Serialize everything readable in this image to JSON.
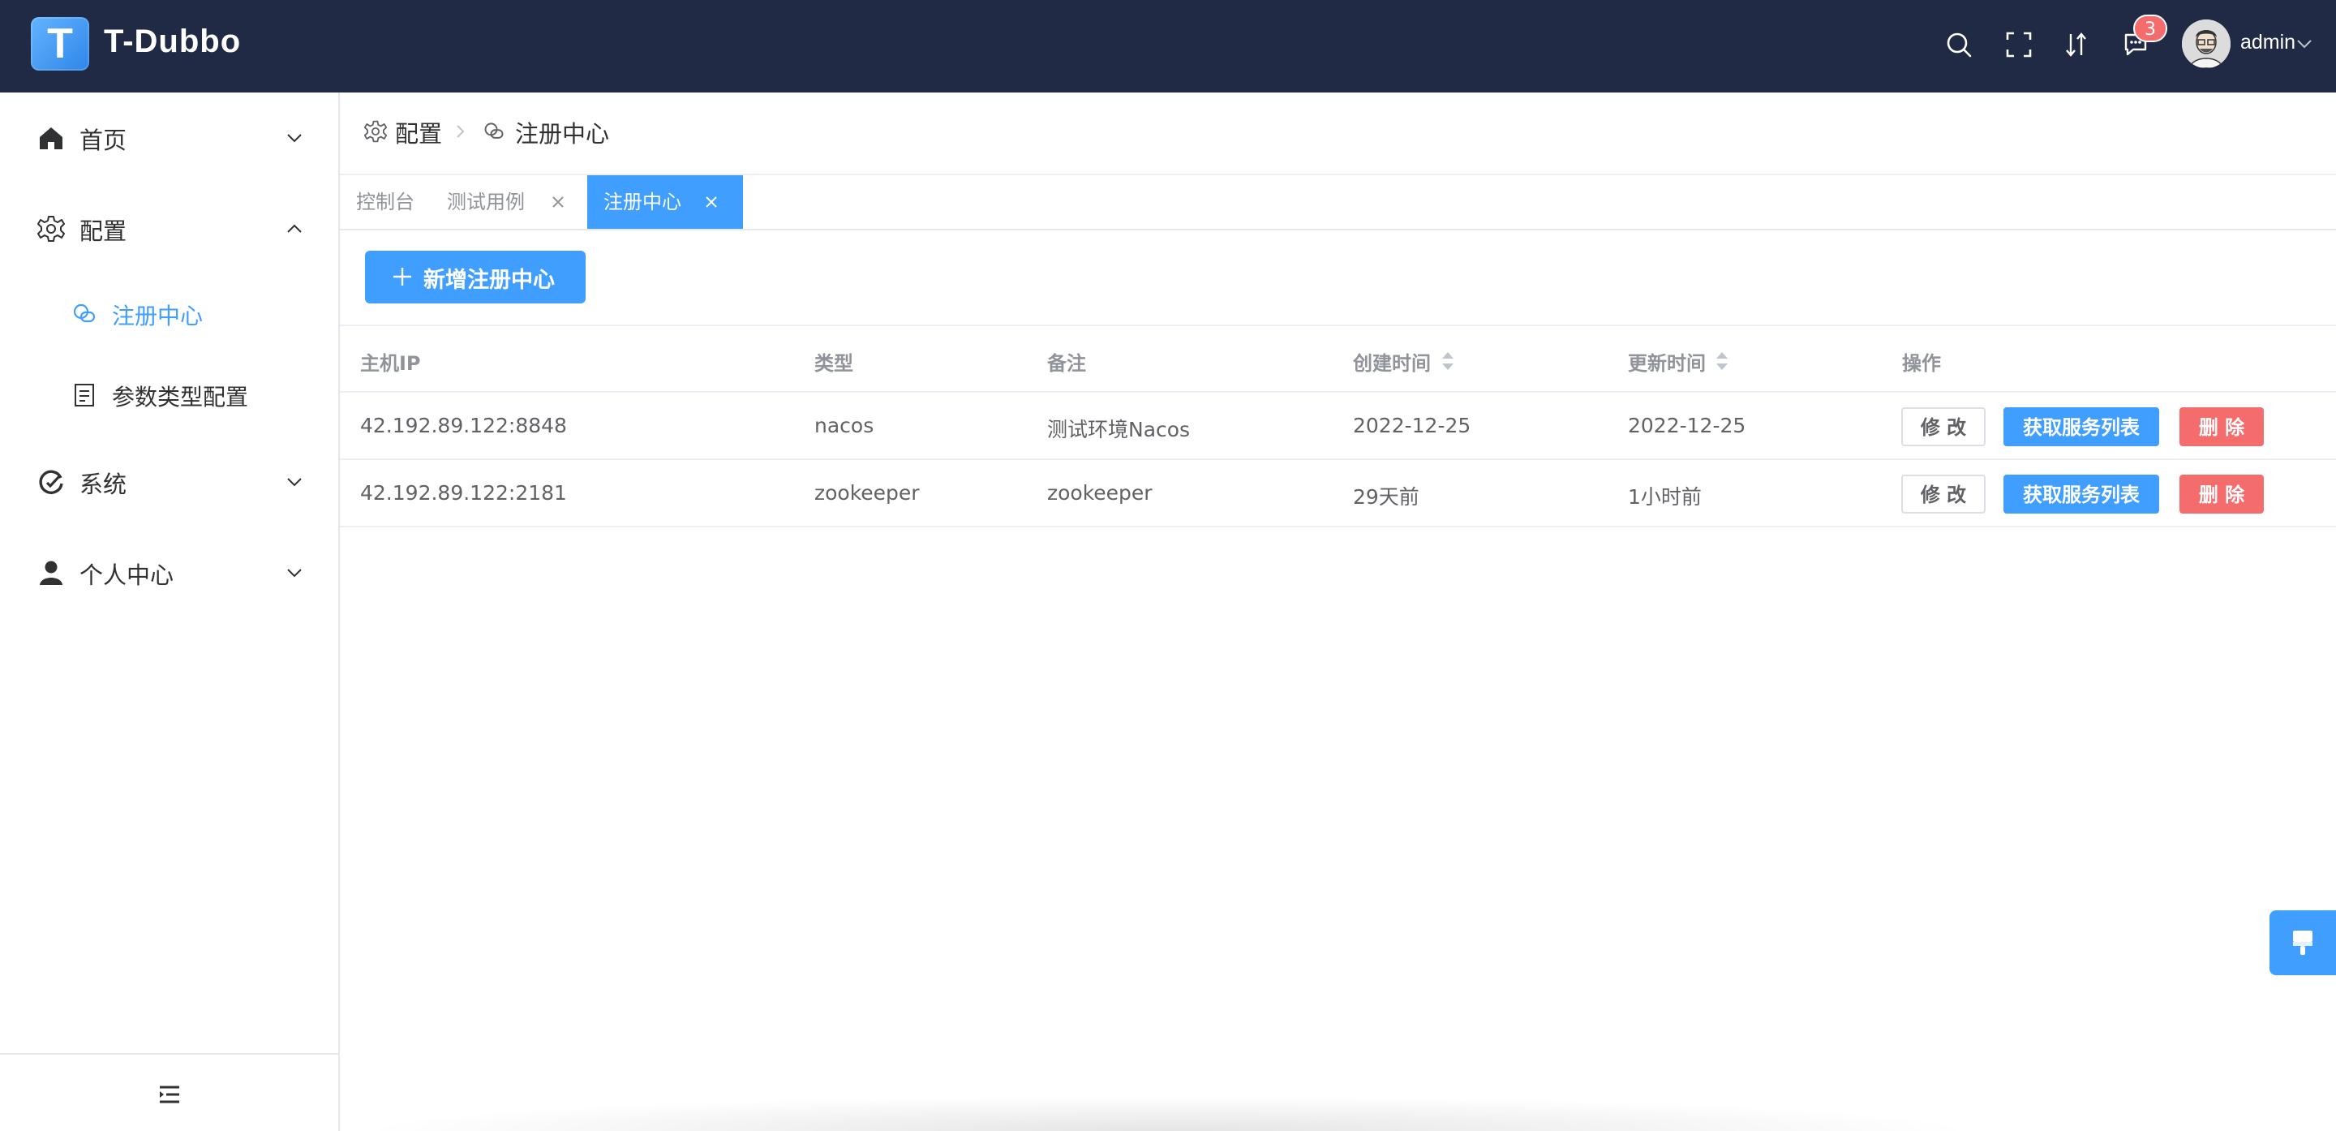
{
  "header": {
    "logo_letter": "T",
    "app_title": "T-Dubbo",
    "notification_count": "3",
    "username": "admin",
    "bg_color": "#212a44",
    "icons": [
      "search-icon",
      "fullscreen-icon",
      "font-size-icon",
      "message-icon",
      "avatar",
      "chevron-down-icon"
    ]
  },
  "sidebar": {
    "items": [
      {
        "label": "首页",
        "icon": "home-icon",
        "expanded": false
      },
      {
        "label": "配置",
        "icon": "gear-icon",
        "expanded": true,
        "children": [
          {
            "label": "注册中心",
            "icon": "link-icon",
            "active": true
          },
          {
            "label": "参数类型配置",
            "icon": "document-icon",
            "active": false
          }
        ]
      },
      {
        "label": "系统",
        "icon": "system-icon",
        "expanded": false
      },
      {
        "label": "个人中心",
        "icon": "user-icon",
        "expanded": false
      }
    ],
    "footer_icon": "collapse-menu-icon"
  },
  "breadcrumb": {
    "items": [
      {
        "label": "配置",
        "icon": "gear-icon"
      },
      {
        "label": "注册中心",
        "icon": "link-icon"
      }
    ]
  },
  "tabs": [
    {
      "label": "控制台",
      "closable": false,
      "active": false
    },
    {
      "label": "测试用例",
      "closable": true,
      "active": false
    },
    {
      "label": "注册中心",
      "closable": true,
      "active": true
    }
  ],
  "toolbar": {
    "add_label": "新增注册中心"
  },
  "table": {
    "columns": [
      "主机IP",
      "类型",
      "备注",
      "创建时间",
      "更新时间",
      "操作"
    ],
    "sortable": [
      "创建时间",
      "更新时间"
    ],
    "rows": [
      {
        "host": "42.192.89.122:8848",
        "type": "nacos",
        "remark": "测试环境Nacos",
        "created": "2022-12-25",
        "updated": "2022-12-25"
      },
      {
        "host": "42.192.89.122:2181",
        "type": "zookeeper",
        "remark": "zookeeper",
        "created": "29天前",
        "updated": "1小时前"
      }
    ],
    "actions": {
      "edit": "修 改",
      "list": "获取服务列表",
      "delete": "删 除"
    }
  },
  "colors": {
    "primary": "#409eff",
    "danger": "#f56c6c",
    "header_bg": "#212a44"
  }
}
